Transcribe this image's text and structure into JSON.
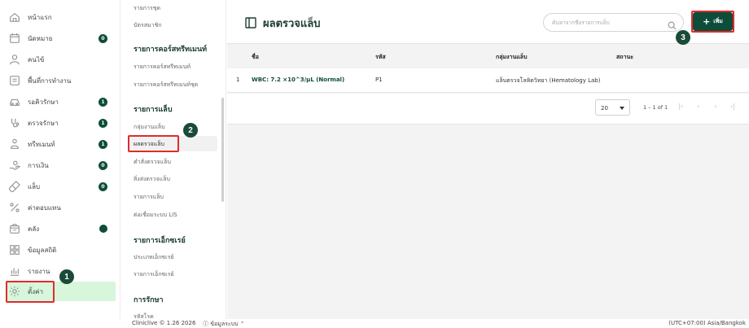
{
  "sidebar": {
    "items": [
      {
        "label": "หน้าแรก",
        "icon": "home-icon"
      },
      {
        "label": "นัดหมาย",
        "icon": "calendar-icon",
        "badge": "0"
      },
      {
        "label": "คนไข้",
        "icon": "user-icon"
      },
      {
        "label": "พื้นที่การทำงาน",
        "icon": "workspace-icon"
      },
      {
        "label": "รอคิวรักษา",
        "icon": "car-icon",
        "badge": "1"
      },
      {
        "label": "ตรวจรักษา",
        "icon": "stethoscope-icon",
        "badge": "1"
      },
      {
        "label": "ทรีทเมนท์",
        "icon": "treatment-icon",
        "badge": "1"
      },
      {
        "label": "การเงิน",
        "icon": "payment-icon",
        "badge": "0"
      },
      {
        "label": "แล็บ",
        "icon": "test-tube-icon",
        "badge": "0"
      },
      {
        "label": "ค่าตอบแทน",
        "icon": "percent-icon"
      },
      {
        "label": "คลัง",
        "icon": "inventory-icon",
        "dot": true
      },
      {
        "label": "ข้อมูลสถิติ",
        "icon": "statistics-icon"
      },
      {
        "label": "รายงาน",
        "icon": "report-icon"
      },
      {
        "label": "ตั้งค่า",
        "icon": "gear-icon"
      }
    ]
  },
  "submenu": {
    "items_top": [
      "รายการชุด",
      "บัตรสมาชิก"
    ],
    "section_treatment": "รายการคอร์สทรีทเมนท์",
    "treatment_items": [
      "รายการคอร์สทรีทเมนท์",
      "รายการคอร์สทรีทเมนท์ชุด"
    ],
    "section_lab": "รายการแล็บ",
    "lab_items": [
      "กลุ่มงานแล็บ",
      "ผลตรวจแล็บ",
      "คำสั่งตรวจแล็บ",
      "สิ่งส่งตรวจแล็บ",
      "รายการแล็บ",
      "ต่อเชื่อมระบบ LIS"
    ],
    "section_xray": "รายการเอ็กซเรย์",
    "xray_items": [
      "ประเภทเอ็กซเรย์",
      "รายการเอ็กซเรย์"
    ],
    "section_treat": "การรักษา",
    "treat_items": [
      "รหัสโรค"
    ]
  },
  "main": {
    "title": "ผลตรวจแล็บ",
    "search_placeholder": "ค้นหาจากชื่อรายการแล็บ",
    "add_label": "เพิ่ม",
    "columns": [
      "ชื่อ",
      "รหัส",
      "กลุ่มงานแล็บ",
      "สถานะ"
    ],
    "rows": [
      {
        "index": "1",
        "name": "WBC: 7.2 ×10^3/µL (Normal)",
        "code": "P1",
        "group": "แล็บตรวจโลหิตวิทยา (Hematology Lab)",
        "status": ""
      }
    ],
    "page_size": "20",
    "range": "1 – 1 of 1"
  },
  "footer": {
    "copyright": "Cliniclive © 1.26 2026",
    "system_info": "ⓘ ข้อมูลระบบ ⌃",
    "timezone": "(UTC+07:00) Asia/Bangkok"
  },
  "annotations": [
    "1",
    "2",
    "3"
  ],
  "colors": {
    "brand": "#0e4d3a",
    "highlight": "#e02b2b",
    "active_bg": "#d7f6dc"
  }
}
